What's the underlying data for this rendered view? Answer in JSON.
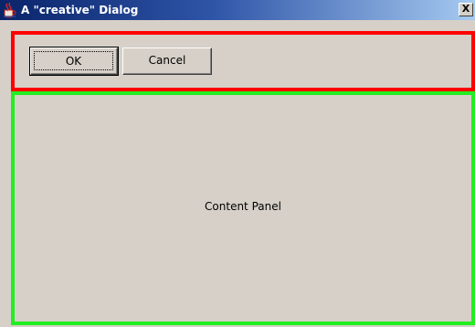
{
  "window": {
    "title": "A \"creative\" Dialog",
    "close_label": "X"
  },
  "button_panel": {
    "ok_label": "OK",
    "cancel_label": "Cancel",
    "border_color": "#ff0000"
  },
  "content_panel": {
    "label": "Content Panel",
    "border_color": "#22ee22"
  },
  "icons": {
    "app": "java-coffee-cup-icon",
    "close": "close-icon"
  }
}
